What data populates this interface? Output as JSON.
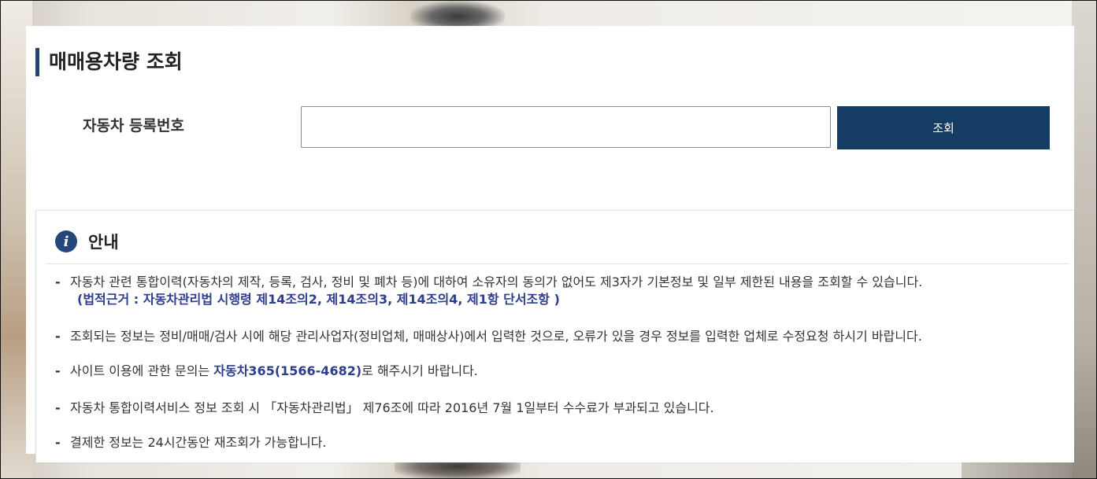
{
  "page": {
    "title": "매매용차량 조회"
  },
  "search": {
    "label": "자동차 등록번호",
    "input_value": "",
    "button_label": "조회"
  },
  "info": {
    "title": "안내",
    "icon": "info-icon",
    "notices": [
      {
        "text": "자동차 관련 통합이력(자동차의 제작, 등록, 검사, 정비 및 폐차 등)에 대하여 소유자의 동의가 없어도 제3자가 기본정보 및 일부 제한된 내용을 조회할 수 있습니다.",
        "legal": "(법적근거 : 자동차관리법 시행령 제14조의2, 제14조의3, 제14조의4, 제1항 단서조항 )"
      },
      {
        "text": "조회되는 정보는 정비/매매/검사 시에 해당 관리사업자(정비업체, 매매상사)에서 입력한 것으로, 오류가 있을 경우 정보를 입력한 업체로 수정요청 하시기 바랍니다."
      },
      {
        "before": "사이트 이용에 관한 문의는 ",
        "highlight": "자동차365(1566-4682)",
        "after": "로 해주시기 바랍니다."
      },
      {
        "text": "자동차 통합이력서비스 정보 조회 시 「자동차관리법」 제76조에 따라 2016년 7월 1일부터 수수료가 부과되고 있습니다."
      },
      {
        "text": "결제한 정보는 24시간동안 재조회가 가능합니다."
      }
    ],
    "bullet": "-"
  },
  "colors": {
    "accent": "#153c63",
    "title_bar": "#23456e",
    "highlight": "#2f3d8f"
  }
}
